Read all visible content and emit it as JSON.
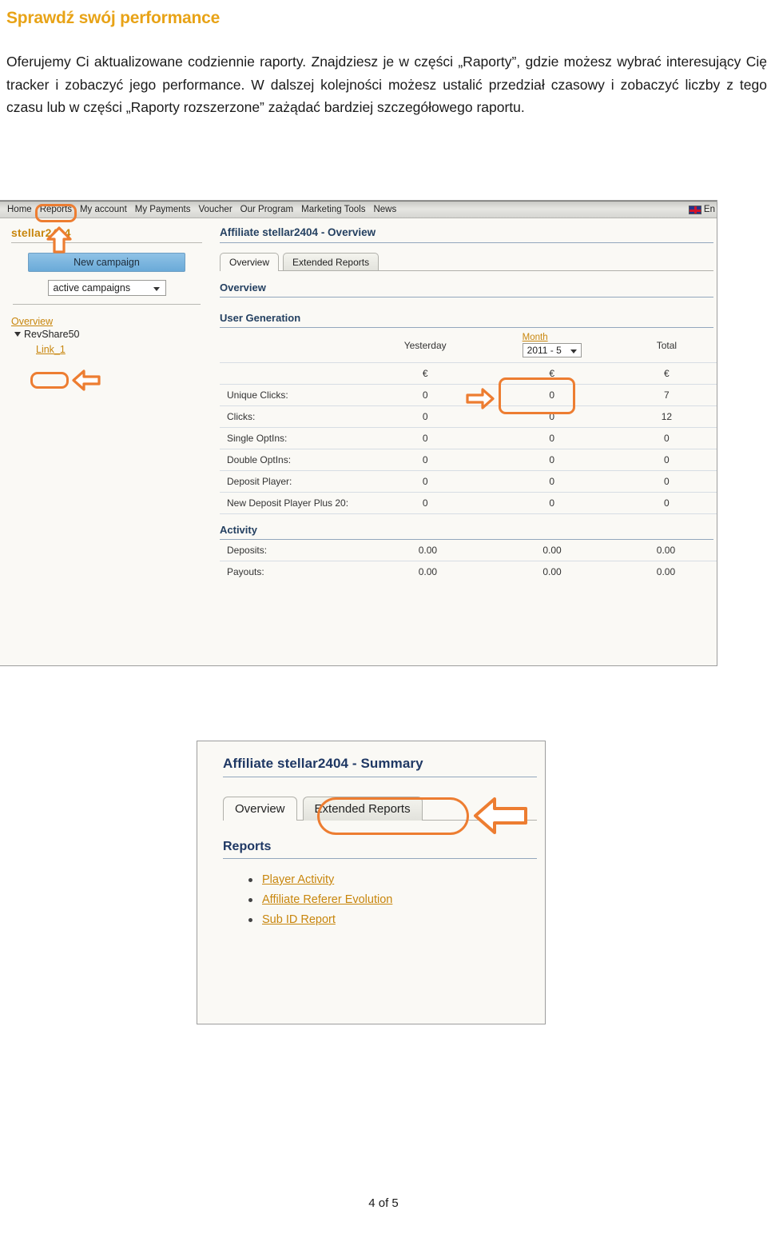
{
  "document": {
    "heading": "Sprawdź swój performance",
    "paragraph": "Oferujemy Ci aktualizowane codziennie raporty. Znajdziesz je w części „Raporty”, gdzie możesz wybrać interesujący Cię tracker i zobaczyć jego performance. W dalszej kolejności możesz ustalić przedział czasowy i zobaczyć liczby z tego czasu lub w części „Raporty rozszerzone” zażądać bardziej szczegółowego raportu.",
    "footer": "4 of 5"
  },
  "screenshot1": {
    "navbar": {
      "items": [
        {
          "label": "Home"
        },
        {
          "label": "Reports"
        },
        {
          "label": "My account"
        },
        {
          "label": "My Payments"
        },
        {
          "label": "Voucher"
        },
        {
          "label": "Our Program"
        },
        {
          "label": "Marketing Tools"
        },
        {
          "label": "News"
        }
      ],
      "language": "En",
      "flag_icon": "uk-flag-icon"
    },
    "sidebar": {
      "username": "stellar2404",
      "new_campaign_button": "New campaign",
      "campaign_filter": "active campaigns",
      "overview_link": "Overview",
      "tree_node": "RevShare50",
      "tree_child": "Link_1"
    },
    "main": {
      "panel_title": "Affiliate stellar2404 - Overview",
      "tabs": [
        {
          "label": "Overview",
          "active": true
        },
        {
          "label": "Extended Reports",
          "active": false
        }
      ],
      "section_overview": "Overview",
      "section_user_generation": "User Generation",
      "section_activity": "Activity",
      "columns": {
        "yesterday": "Yesterday",
        "month_label": "Month",
        "month_value": "2011 - 5",
        "total": "Total"
      },
      "currency_symbol": "€",
      "user_generation_rows": [
        {
          "label": "Unique Clicks:",
          "yesterday": "0",
          "month": "0",
          "total": "7"
        },
        {
          "label": "Clicks:",
          "yesterday": "0",
          "month": "0",
          "total": "12"
        },
        {
          "label": "Single OptIns:",
          "yesterday": "0",
          "month": "0",
          "total": "0"
        },
        {
          "label": "Double OptIns:",
          "yesterday": "0",
          "month": "0",
          "total": "0"
        },
        {
          "label": "Deposit Player:",
          "yesterday": "0",
          "month": "0",
          "total": "0"
        },
        {
          "label": "New Deposit Player Plus 20:",
          "yesterday": "0",
          "month": "0",
          "total": "0"
        }
      ],
      "activity_rows": [
        {
          "label": "Deposits:",
          "yesterday": "0.00",
          "month": "0.00",
          "total": "0.00"
        },
        {
          "label": "Payouts:",
          "yesterday": "0.00",
          "month": "0.00",
          "total": "0.00"
        }
      ]
    }
  },
  "screenshot2": {
    "title": "Affiliate stellar2404 - Summary",
    "tabs": [
      {
        "label": "Overview",
        "active": true
      },
      {
        "label": "Extended Reports",
        "active": false
      }
    ],
    "section_reports": "Reports",
    "report_links": [
      {
        "label": "Player Activity"
      },
      {
        "label": "Affiliate Referer Evolution"
      },
      {
        "label": "Sub ID Report"
      }
    ]
  },
  "colors": {
    "heading_orange": "#E8A317",
    "annotation_orange": "#ED7D31",
    "link_orange": "#C8860D",
    "panel_blue": "#244061",
    "button_blue": "#6aaad8"
  }
}
